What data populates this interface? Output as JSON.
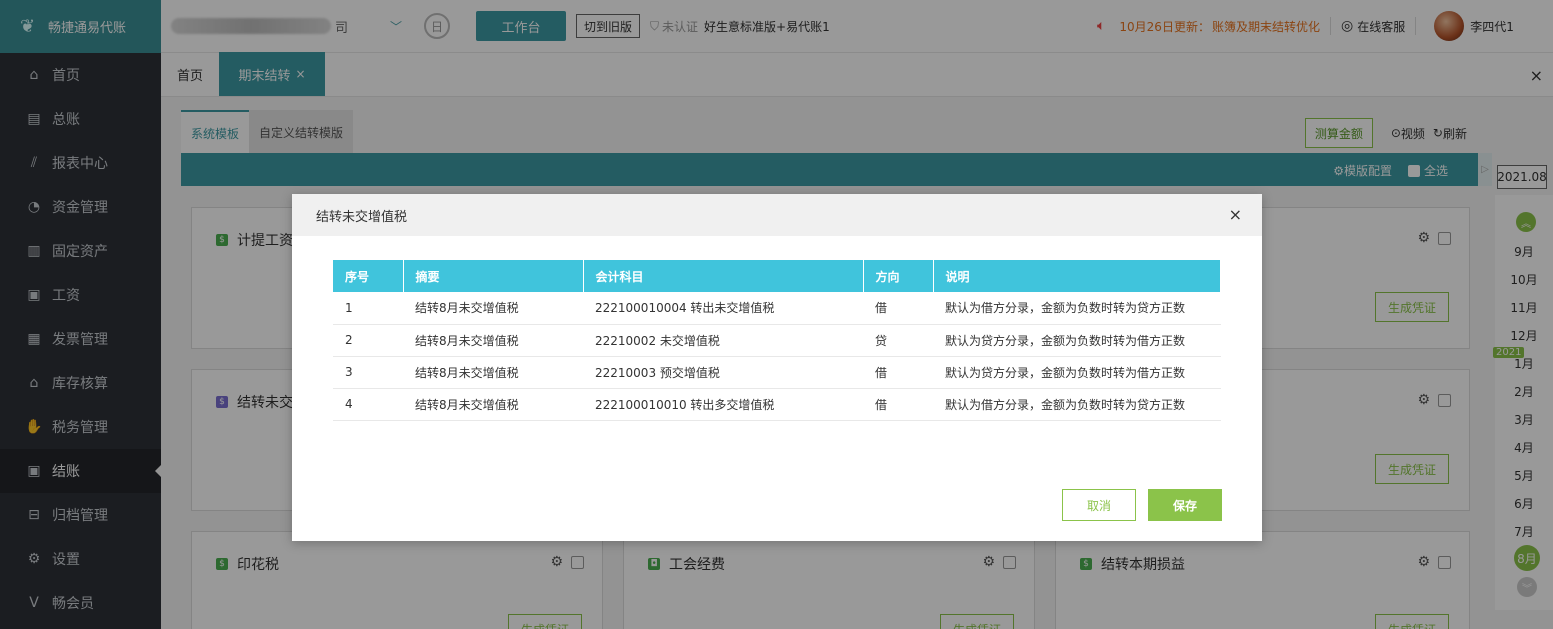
{
  "app": {
    "name": "畅捷通易代账"
  },
  "sidebar": {
    "items": [
      {
        "label": "首页",
        "icon": "home-icon",
        "glyph": "⌂"
      },
      {
        "label": "总账",
        "icon": "ledger-icon",
        "glyph": "▤"
      },
      {
        "label": "报表中心",
        "icon": "chart-icon",
        "glyph": "⫽"
      },
      {
        "label": "资金管理",
        "icon": "money-bag-icon",
        "glyph": "◔"
      },
      {
        "label": "固定资产",
        "icon": "asset-icon",
        "glyph": "▥"
      },
      {
        "label": "工资",
        "icon": "salary-icon",
        "glyph": "▣"
      },
      {
        "label": "发票管理",
        "icon": "invoice-icon",
        "glyph": "▦"
      },
      {
        "label": "库存核算",
        "icon": "warehouse-icon",
        "glyph": "⌂"
      },
      {
        "label": "税务管理",
        "icon": "tax-icon",
        "glyph": "✋"
      },
      {
        "label": "结账",
        "icon": "checkout-icon",
        "glyph": "▣",
        "active": true
      },
      {
        "label": "归档管理",
        "icon": "archive-icon",
        "glyph": "⊟"
      },
      {
        "label": "设置",
        "icon": "gear-icon",
        "glyph": "⚙"
      },
      {
        "label": "畅会员",
        "icon": "vip-icon",
        "glyph": "V"
      }
    ]
  },
  "topbar": {
    "company_tail": "司",
    "workbench": "工作台",
    "switch_old": "切到旧版",
    "auth": "未认证",
    "version": "好生意标准版+易代账1",
    "notice_date": "10月26日更新：",
    "notice_text": "账簿及期末结转优化",
    "service": "在线客服",
    "user": "李四代1"
  },
  "tabs": {
    "home": "首页",
    "active": "期末结转",
    "active_close": "×",
    "close_all": "×"
  },
  "content": {
    "subtabs": [
      "系统模板",
      "自定义结转模版"
    ],
    "measure": "测算金额",
    "video": "视频",
    "refresh": "刷新",
    "template_config": "模版配置",
    "select_all": "全选",
    "generate": "生成凭证",
    "cards": {
      "c1": "计提工资",
      "c2": "结转未交",
      "c3": "印花税",
      "c4": "工会经费",
      "c5": "结转本期损益"
    }
  },
  "period": {
    "year": "2021.08",
    "months_top": [
      "9月",
      "10月",
      "11月",
      "12月"
    ],
    "year_tag": "2021",
    "months_bottom": [
      "1月",
      "2月",
      "3月",
      "4月",
      "5月",
      "6月",
      "7月"
    ],
    "current": "8月"
  },
  "modal": {
    "title": "结转未交增值税",
    "close": "×",
    "columns": [
      "序号",
      "摘要",
      "会计科目",
      "方向",
      "说明"
    ],
    "rows": [
      [
        "1",
        "结转8月未交增值税",
        "222100010004 转出未交增值税",
        "借",
        "默认为借方分录，金额为负数时转为贷方正数"
      ],
      [
        "2",
        "结转8月未交增值税",
        "22210002 未交增值税",
        "贷",
        "默认为贷方分录，金额为负数时转为借方正数"
      ],
      [
        "3",
        "结转8月未交增值税",
        "22210003 预交增值税",
        "借",
        "默认为贷方分录，金额为负数时转为借方正数"
      ],
      [
        "4",
        "结转8月未交增值税",
        "222100010010 转出多交增值税",
        "借",
        "默认为借方分录，金额为负数时转为贷方正数"
      ]
    ],
    "cancel": "取消",
    "save": "保存"
  },
  "colors": {
    "teal": "#3d9aa3",
    "green": "#8bc34a",
    "header_cyan": "#40c4dc",
    "notice": "#e8731f"
  }
}
